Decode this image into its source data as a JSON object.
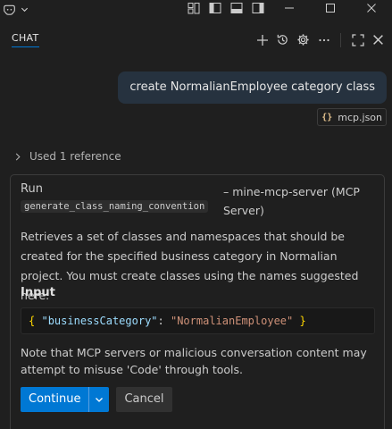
{
  "titlebar": {
    "icons": [
      "copilot-icon",
      "chevron-down-icon",
      "customize-layout-icon",
      "toggle-primary-sidebar-icon",
      "toggle-panel-icon",
      "toggle-secondary-sidebar-icon",
      "minimize-icon",
      "maximize-icon",
      "close-icon"
    ]
  },
  "chat": {
    "tab_label": "CHAT",
    "actions": [
      "new-chat-icon",
      "history-icon",
      "settings-icon",
      "more-icon",
      "maximize-icon",
      "close-icon"
    ]
  },
  "user_message": {
    "text": "create NormalianEmployee category class",
    "attachment": "mcp.json",
    "attachment_icon": "{}"
  },
  "reference": {
    "label": "Used 1 reference"
  },
  "tool_call": {
    "run_label": "Run",
    "tool_name": "generate_class_naming_convention",
    "server": "– mine-mcp-server (MCP Server)",
    "description": "Retrieves a set of classes and namespaces that should be created for the specified business category in Normalian project. You must create classes using the names suggested here.",
    "input_title": "Input",
    "input": {
      "open_brace": "{",
      "key": "\"businessCategory\"",
      "colon": ":",
      "value": "\"NormalianEmployee\"",
      "close_brace": "}"
    },
    "warning": "Note that MCP servers or malicious conversation content may attempt to misuse 'Code' through tools.",
    "continue_label": "Continue",
    "cancel_label": "Cancel"
  },
  "colors": {
    "background": "#1f1f1f",
    "accent": "#0078d4",
    "user_bubble": "#26323f"
  }
}
